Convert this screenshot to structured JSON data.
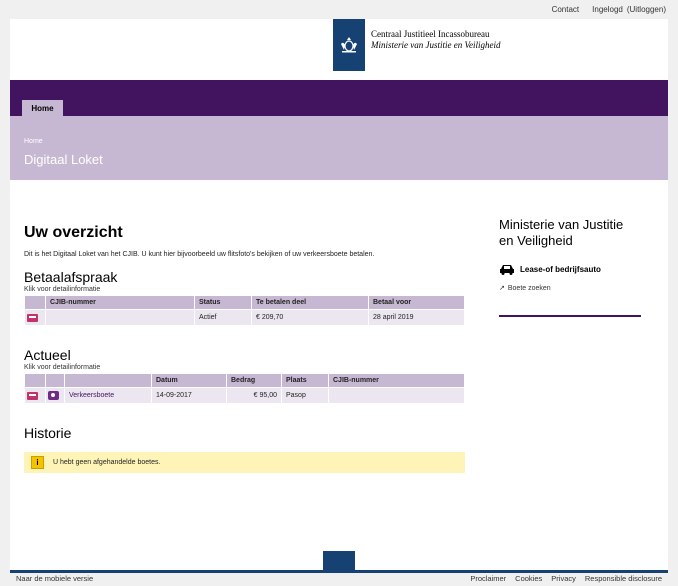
{
  "topbar": {
    "contact": "Contact",
    "logged_in": "Ingelogd",
    "logout": "(Uitloggen)"
  },
  "logo": {
    "line1": "Centraal Justitieel Incassobureau",
    "line2": "Ministerie van Justitie en Veiligheid"
  },
  "nav": {
    "home_tab": "Home"
  },
  "hero": {
    "breadcrumb": "Home",
    "title": "Digitaal Loket"
  },
  "main": {
    "heading": "Uw overzicht",
    "intro": "Dit is het Digitaal Loket van het CJIB. U kunt hier bijvoorbeeld uw flitsfoto's bekijken of uw verkeersboete betalen.",
    "betaal": {
      "title": "Betaalafspraak",
      "hint": "Klik voor detailinformatie",
      "headers": [
        "CJIB-nummer",
        "Status",
        "Te betalen deel",
        "Betaal voor"
      ],
      "row": {
        "icon": "payment-card-icon",
        "cjib": "",
        "status": "Actief",
        "amount": "€ 209,70",
        "date": "28 april 2019"
      }
    },
    "actueel": {
      "title": "Actueel",
      "hint": "Klik voor detailinformatie",
      "headers": [
        "Datum",
        "Bedrag",
        "Plaats",
        "CJIB-nummer"
      ],
      "row": {
        "icon1": "payment-card-icon",
        "icon2": "camera-icon",
        "name": "Verkeersboete",
        "datum": "14-09-2017",
        "bedrag": "€ 95,00",
        "plaats": "Pasop",
        "cjib": ""
      }
    },
    "historie": {
      "title": "Historie",
      "notice": "U hebt geen afgehandelde boetes."
    }
  },
  "sidebar": {
    "ministry": "Ministerie van Justitie en Veiligheid",
    "lease": "Lease-of bedrijfsauto",
    "boete_link": "Boete zoeken"
  },
  "footer": {
    "mobile": "Naar de mobiele versie",
    "links": [
      "Proclaimer",
      "Cookies",
      "Privacy",
      "Responsible disclosure"
    ]
  },
  "colors": {
    "brand_purple": "#42145f",
    "light_purple": "#c6b8d2",
    "rijks_blue": "#154273",
    "notice_yellow": "#fff4b8"
  }
}
